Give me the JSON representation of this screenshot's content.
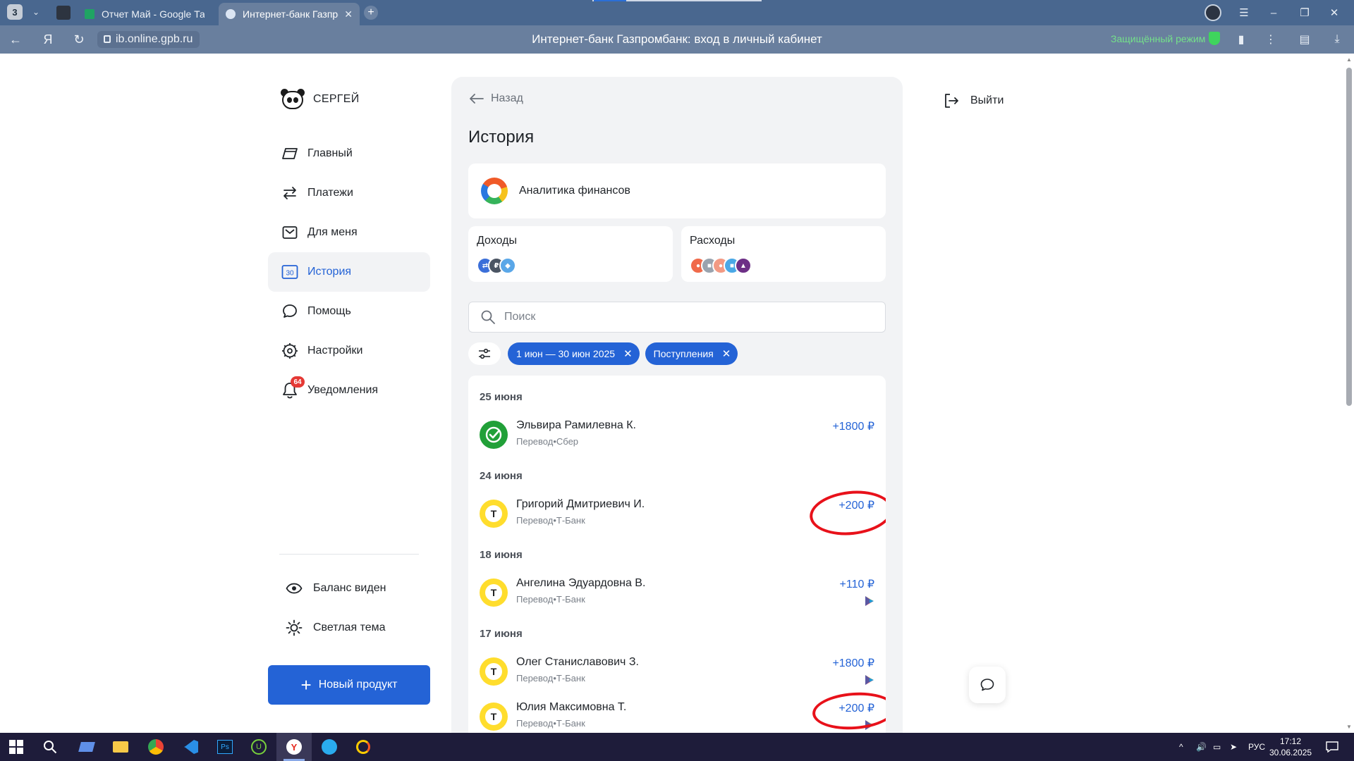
{
  "browser": {
    "tab_count": "3",
    "tabs": [
      {
        "label": "Отчет Май - Google Табл"
      },
      {
        "label": "Интернет-банк Газпро"
      }
    ],
    "url": "ib.online.gpb.ru",
    "page_title": "Интернет-банк Газпромбанк: вход в личный кабинет",
    "protected_mode": "Защищённый режим"
  },
  "sidebar": {
    "user_name": "СЕРГЕЙ",
    "nav": [
      {
        "label": "Главный",
        "icon": "card-icon"
      },
      {
        "label": "Платежи",
        "icon": "transfer-arrows-icon"
      },
      {
        "label": "Для меня",
        "icon": "envelope-icon"
      },
      {
        "label": "История",
        "icon": "calendar-icon",
        "icon_text": "30"
      },
      {
        "label": "Помощь",
        "icon": "chat-bubble-icon"
      },
      {
        "label": "Настройки",
        "icon": "gear-icon"
      },
      {
        "label": "Уведомления",
        "icon": "bell-icon",
        "badge": "64"
      }
    ],
    "balance_label": "Баланс виден",
    "theme_label": "Светлая тема",
    "new_product_label": "Новый продукт"
  },
  "main": {
    "back_label": "Назад",
    "title": "История",
    "analytics_label": "Аналитика финансов",
    "income_label": "Доходы",
    "expense_label": "Расходы",
    "search_placeholder": "Поиск",
    "filters": {
      "date_range": "1 июн — 30 июн 2025",
      "type": "Поступления"
    },
    "groups": [
      {
        "date": "25 июня",
        "items": [
          {
            "name": "Эльвира Рамилевна К.",
            "sub": "Перевод•Сбер",
            "amount": "+1800 ₽",
            "bank": "sber",
            "sbp": false,
            "circled": false
          }
        ]
      },
      {
        "date": "24 июня",
        "items": [
          {
            "name": "Григорий Дмитриевич И.",
            "sub": "Перевод•Т-Банк",
            "amount": "+200 ₽",
            "bank": "tbank",
            "sbp": false,
            "circled": true
          }
        ]
      },
      {
        "date": "18 июня",
        "items": [
          {
            "name": "Ангелина Эдуардовна В.",
            "sub": "Перевод•Т-Банк",
            "amount": "+110 ₽",
            "bank": "tbank",
            "sbp": true,
            "circled": false
          }
        ]
      },
      {
        "date": "17 июня",
        "items": [
          {
            "name": "Олег Станиславович З.",
            "sub": "Перевод•Т-Банк",
            "amount": "+1800 ₽",
            "bank": "tbank",
            "sbp": true,
            "circled": false
          },
          {
            "name": "Юлия Максимовна Т.",
            "sub": "Перевод•Т-Банк",
            "amount": "+200 ₽",
            "bank": "tbank",
            "sbp": true,
            "circled": true
          }
        ]
      }
    ],
    "logout_label": "Выйти"
  },
  "taskbar": {
    "language": "РУС",
    "time": "17:12",
    "date": "30.06.2025"
  },
  "colors": {
    "accent": "#2463d6",
    "annotation": "#e8111a",
    "tbank": "#ffdd2d",
    "sber": "#21a038",
    "notification_badge": "#e53935"
  }
}
